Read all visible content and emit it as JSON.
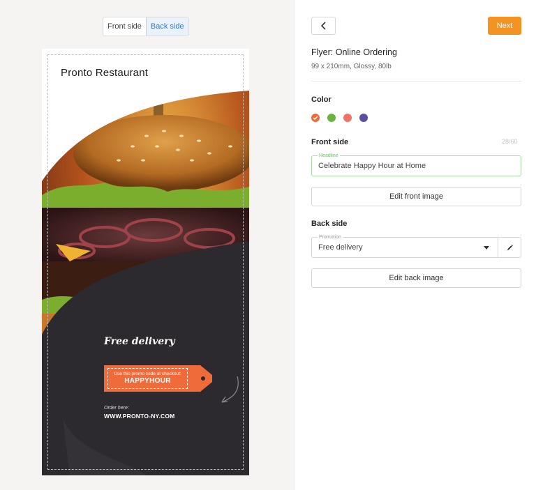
{
  "preview": {
    "toggle": {
      "front_label": "Front side",
      "back_label": "Back side",
      "active": "back"
    },
    "flyer": {
      "restaurant_name": "Pronto Restaurant",
      "promotion_headline": "Free delivery",
      "tag_line": "Use this promo code at checkout:",
      "promo_code": "HAPPYHOUR",
      "order_label": "Order here:",
      "order_url": "WWW.PRONTO-NY.COM"
    }
  },
  "editor": {
    "back_icon": "chevron-left-icon",
    "next_label": "Next",
    "product_title": "Flyer: Online Ordering",
    "product_spec": "99 x 210mm, Glossy, 80lb",
    "color_label": "Color",
    "colors": [
      {
        "name": "orange",
        "hex": "#ef6b3a",
        "selected": true
      },
      {
        "name": "green",
        "hex": "#6ab33f",
        "selected": false
      },
      {
        "name": "salmon",
        "hex": "#f27266",
        "selected": false
      },
      {
        "name": "purple",
        "hex": "#5b4da3",
        "selected": false
      }
    ],
    "front_side": {
      "label": "Front side",
      "counter": "28/60",
      "headline_legend": "Headline",
      "headline_value": "Celebrate Happy Hour at Home",
      "edit_image_label": "Edit front image"
    },
    "back_side": {
      "label": "Back side",
      "promotion_legend": "Promotion",
      "promotion_value": "Free delivery",
      "edit_icon": "pencil-icon",
      "edit_image_label": "Edit back image"
    }
  }
}
